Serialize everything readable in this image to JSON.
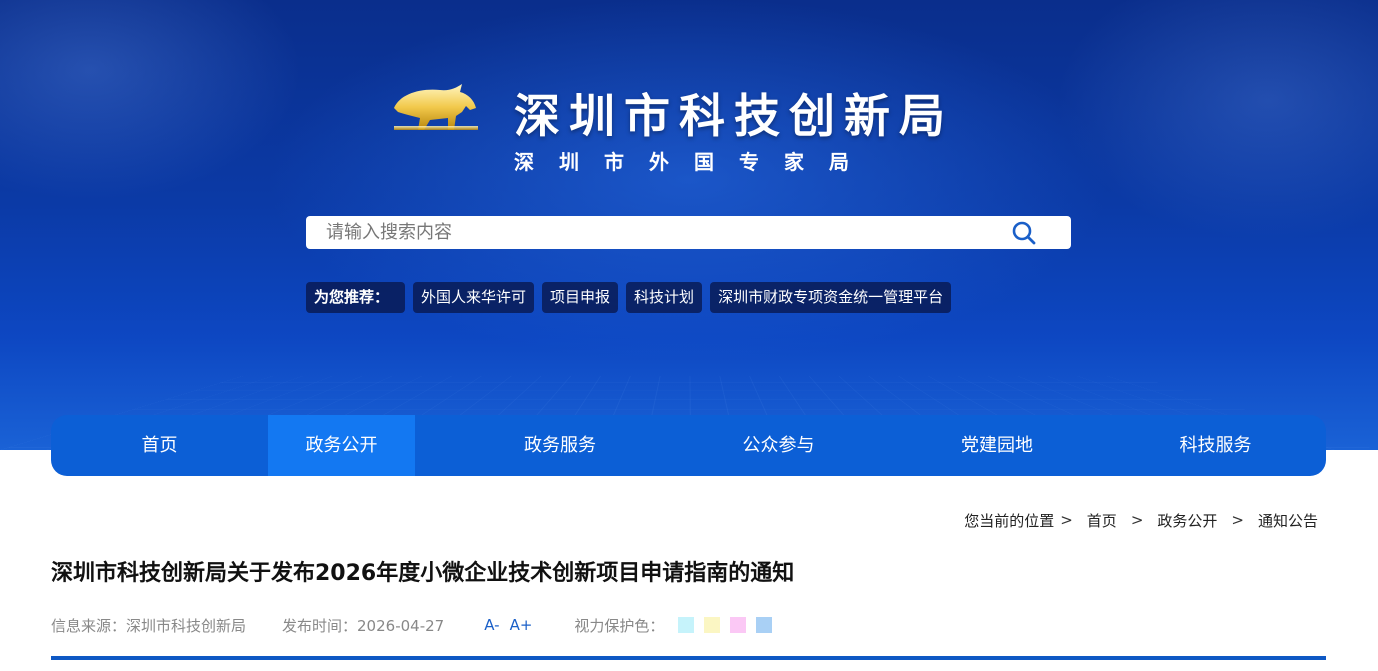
{
  "header": {
    "org_name": "深圳市科技创新局",
    "org_sub_name": "深圳市外国专家局"
  },
  "search": {
    "placeholder": "请输入搜索内容"
  },
  "recommend": {
    "label": "为您推荐：",
    "items": [
      "外国人来华许可",
      "项目申报",
      "科技计划",
      "深圳市财政专项资金统一管理平台"
    ]
  },
  "nav": {
    "items": [
      "首页",
      "政务公开",
      "政务服务",
      "公众参与",
      "党建园地",
      "科技服务"
    ],
    "active_index": 1
  },
  "breadcrumb": {
    "prefix": "您当前的位置",
    "items": [
      "首页",
      "政务公开",
      "通知公告"
    ],
    "separator": ">"
  },
  "article": {
    "title": "深圳市科技创新局关于发布2026年度小微企业技术创新项目申请指南的通知",
    "source": "信息来源：深圳市科技创新局",
    "publish_time": "发布时间：2026-04-27",
    "font_decrease": "A-",
    "font_increase": "A+",
    "eye_care_label": "视力保护色："
  },
  "colors": {
    "nav_bg": "#0c5fd6",
    "nav_active": "#1378f2",
    "swatches": [
      "#c6f3fb",
      "#fbf6c3",
      "#fbc8f5",
      "#a9d0f5"
    ]
  },
  "icons": {
    "logo": "golden-bull-icon",
    "search": "search-icon"
  }
}
